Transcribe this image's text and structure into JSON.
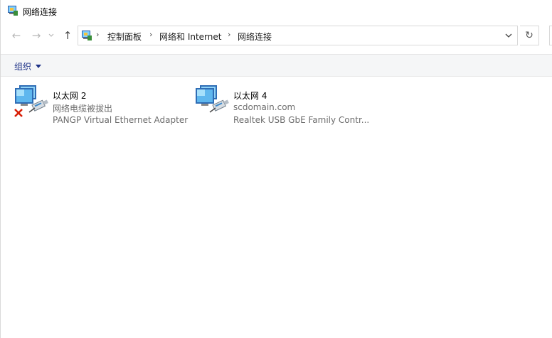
{
  "window": {
    "title": "网络连接",
    "icon": "network-connections-icon"
  },
  "nav": {
    "back_icon": "←",
    "forward_icon": "→",
    "recent_icon": "⌄",
    "up_icon": "↑",
    "breadcrumb": [
      "控制面板",
      "网络和 Internet",
      "网络连接"
    ],
    "separator": "›",
    "refresh_icon": "↻"
  },
  "toolbar": {
    "organize_label": "组织"
  },
  "adapters": [
    {
      "name": "以太网 2",
      "status": "网络电缆被拔出",
      "device": "PANGP Virtual Ethernet Adapter",
      "disconnected": true
    },
    {
      "name": "以太网 4",
      "status": "scdomain.com",
      "device": "Realtek USB GbE Family Contr...",
      "disconnected": false
    }
  ],
  "colors": {
    "accent": "#1e3287",
    "secondary_text": "#6d6d6d",
    "command_bar": "#f5f6f7",
    "disconnect_red": "#d81e06"
  }
}
